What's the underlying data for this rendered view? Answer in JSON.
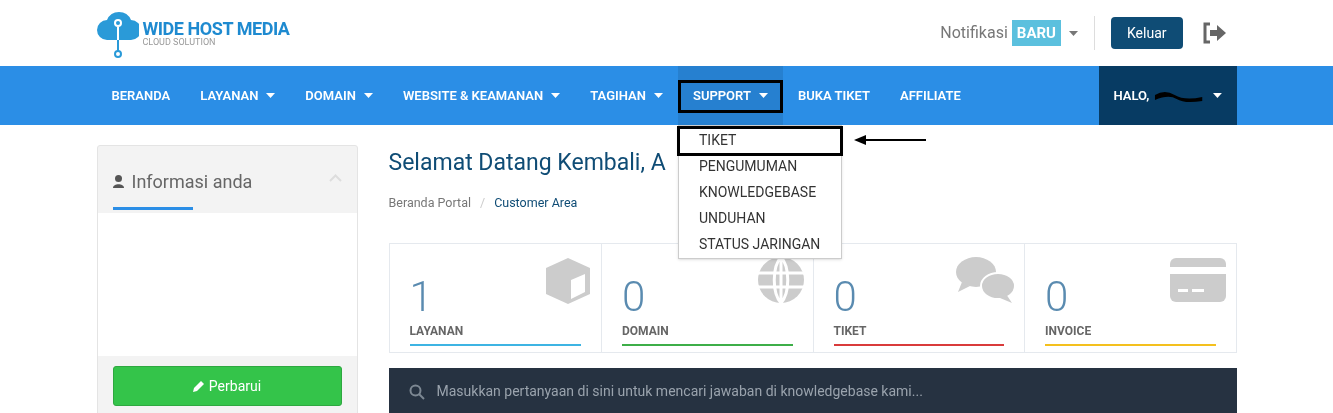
{
  "header": {
    "logo": {
      "name": "WIDE HOST MEDIA",
      "tagline": "CLOUD SOLUTION"
    },
    "notification": {
      "label": "Notifikasi",
      "badge": "BARU"
    },
    "logout_button": "Keluar"
  },
  "nav": {
    "items": [
      {
        "label": "BERANDA",
        "dropdown": false,
        "expanded": false
      },
      {
        "label": "LAYANAN",
        "dropdown": true,
        "expanded": false
      },
      {
        "label": "DOMAIN",
        "dropdown": true,
        "expanded": false
      },
      {
        "label": "WEBSITE & KEAMANAN",
        "dropdown": true,
        "expanded": false
      },
      {
        "label": "TAGIHAN",
        "dropdown": true,
        "expanded": false
      },
      {
        "label": "SUPPORT",
        "dropdown": true,
        "expanded": true,
        "highlighted": true
      },
      {
        "label": "BUKA TIKET",
        "dropdown": false,
        "expanded": false
      },
      {
        "label": "AFFILIATE",
        "dropdown": false,
        "expanded": false
      }
    ],
    "user": {
      "greeting": "HALO,"
    },
    "support_menu": [
      {
        "label": "TIKET",
        "highlighted": true
      },
      {
        "label": "PENGUMUMAN",
        "highlighted": false
      },
      {
        "label": "KNOWLEDGEBASE",
        "highlighted": false
      },
      {
        "label": "UNDUHAN",
        "highlighted": false
      },
      {
        "label": "STATUS JARINGAN",
        "highlighted": false
      }
    ]
  },
  "sidebar": {
    "title": "Informasi anda",
    "button": "Perbarui"
  },
  "main": {
    "heading": "Selamat Datang Kembali, A",
    "breadcrumb": [
      {
        "label": "Beranda Portal",
        "current": false
      },
      {
        "separator": "/",
        "label": "Customer Area",
        "current": true
      }
    ],
    "stats": [
      {
        "value": "1",
        "label": "LAYANAN",
        "color": "#3db4e3",
        "kind": "cube"
      },
      {
        "value": "0",
        "label": "DOMAIN",
        "color": "#3eae48",
        "kind": "globe"
      },
      {
        "value": "0",
        "label": "TIKET",
        "color": "#d93b3b",
        "kind": "chat"
      },
      {
        "value": "0",
        "label": "INVOICE",
        "color": "#f4c01e",
        "kind": "card"
      }
    ],
    "search": {
      "placeholder": "Masukkan pertanyaan di sini untuk mencari jawaban di knowledgebase kami..."
    }
  }
}
